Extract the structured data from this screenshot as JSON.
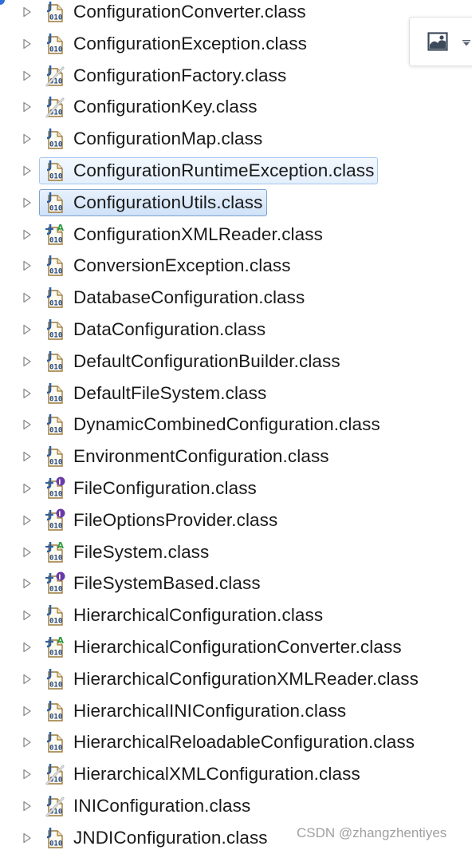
{
  "tree": {
    "items": [
      {
        "label": "ConfigurationConverter.class",
        "icon": "class-file-icon",
        "state": "normal"
      },
      {
        "label": "ConfigurationException.class",
        "icon": "class-file-icon",
        "state": "normal"
      },
      {
        "label": "ConfigurationFactory.class",
        "icon": "deprecated-class-file-icon",
        "state": "normal"
      },
      {
        "label": "ConfigurationKey.class",
        "icon": "deprecated-class-file-icon",
        "state": "normal"
      },
      {
        "label": "ConfigurationMap.class",
        "icon": "class-file-icon",
        "state": "normal"
      },
      {
        "label": "ConfigurationRuntimeException.class",
        "icon": "class-file-icon",
        "state": "selected"
      },
      {
        "label": "ConfigurationUtils.class",
        "icon": "class-file-icon",
        "state": "focused"
      },
      {
        "label": "ConfigurationXMLReader.class",
        "icon": "abstract-class-file-icon",
        "state": "normal"
      },
      {
        "label": "ConversionException.class",
        "icon": "class-file-icon",
        "state": "normal"
      },
      {
        "label": "DatabaseConfiguration.class",
        "icon": "class-file-icon",
        "state": "normal"
      },
      {
        "label": "DataConfiguration.class",
        "icon": "class-file-icon",
        "state": "normal"
      },
      {
        "label": "DefaultConfigurationBuilder.class",
        "icon": "class-file-icon",
        "state": "normal"
      },
      {
        "label": "DefaultFileSystem.class",
        "icon": "class-file-icon",
        "state": "normal"
      },
      {
        "label": "DynamicCombinedConfiguration.class",
        "icon": "class-file-icon",
        "state": "normal"
      },
      {
        "label": "EnvironmentConfiguration.class",
        "icon": "class-file-icon",
        "state": "normal"
      },
      {
        "label": "FileConfiguration.class",
        "icon": "interface-file-icon",
        "state": "normal"
      },
      {
        "label": "FileOptionsProvider.class",
        "icon": "interface-file-icon",
        "state": "normal"
      },
      {
        "label": "FileSystem.class",
        "icon": "abstract-class-file-icon",
        "state": "normal"
      },
      {
        "label": "FileSystemBased.class",
        "icon": "interface-file-icon",
        "state": "normal"
      },
      {
        "label": "HierarchicalConfiguration.class",
        "icon": "class-file-icon",
        "state": "normal"
      },
      {
        "label": "HierarchicalConfigurationConverter.class",
        "icon": "abstract-class-file-icon",
        "state": "normal"
      },
      {
        "label": "HierarchicalConfigurationXMLReader.class",
        "icon": "class-file-icon",
        "state": "normal"
      },
      {
        "label": "HierarchicalINIConfiguration.class",
        "icon": "class-file-icon",
        "state": "normal"
      },
      {
        "label": "HierarchicalReloadableConfiguration.class",
        "icon": "class-file-icon",
        "state": "normal"
      },
      {
        "label": "HierarchicalXMLConfiguration.class",
        "icon": "deprecated-class-file-icon",
        "state": "normal"
      },
      {
        "label": "INIConfiguration.class",
        "icon": "deprecated-class-file-icon",
        "state": "normal"
      },
      {
        "label": "JNDIConfiguration.class",
        "icon": "class-file-icon",
        "state": "normal"
      }
    ]
  },
  "popup": {
    "image_icon": "image-icon",
    "dropdown_icon": "caret-down-icon"
  },
  "watermark": "CSDN @zhangzhentiyes",
  "colors": {
    "selection_border": "#a7c6ee",
    "focus_border": "#7da2ce",
    "text": "#1a1a1a",
    "watermark": "#a0a0a0"
  }
}
